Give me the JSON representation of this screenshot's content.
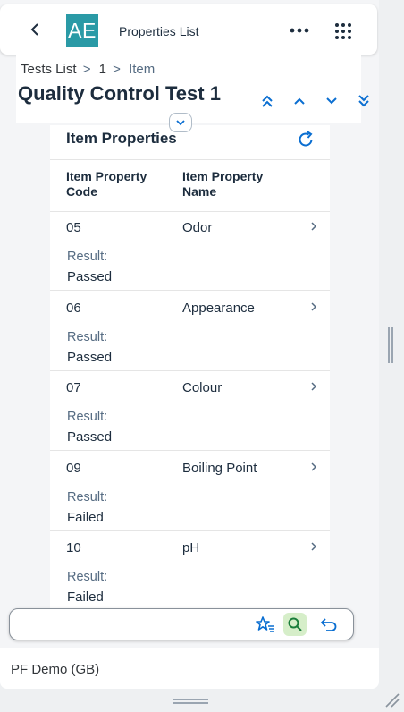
{
  "shell": {
    "logo_text": "AE",
    "app_title": "Properties List"
  },
  "header": {
    "breadcrumbs": [
      "Tests List",
      "1",
      "Item"
    ],
    "separators": [
      ">",
      ">"
    ],
    "title": "Quality Control Test 1"
  },
  "panel": {
    "title": "Item Properties",
    "columns": [
      "Item Property Code",
      "Item Property Name"
    ],
    "result_label": "Result:",
    "rows": [
      {
        "code": "05",
        "name": "Odor",
        "result": "Passed"
      },
      {
        "code": "06",
        "name": "Appearance",
        "result": "Passed"
      },
      {
        "code": "07",
        "name": "Colour",
        "result": "Passed"
      },
      {
        "code": "09",
        "name": "Boiling Point",
        "result": "Failed"
      },
      {
        "code": "10",
        "name": "pH",
        "result": "Failed"
      }
    ]
  },
  "footer": {
    "company": "PF Demo (GB)"
  },
  "colors": {
    "accent": "#0a6ed1",
    "logo_bg": "#2a9aa6",
    "search_active_bg": "#d6eec9"
  }
}
